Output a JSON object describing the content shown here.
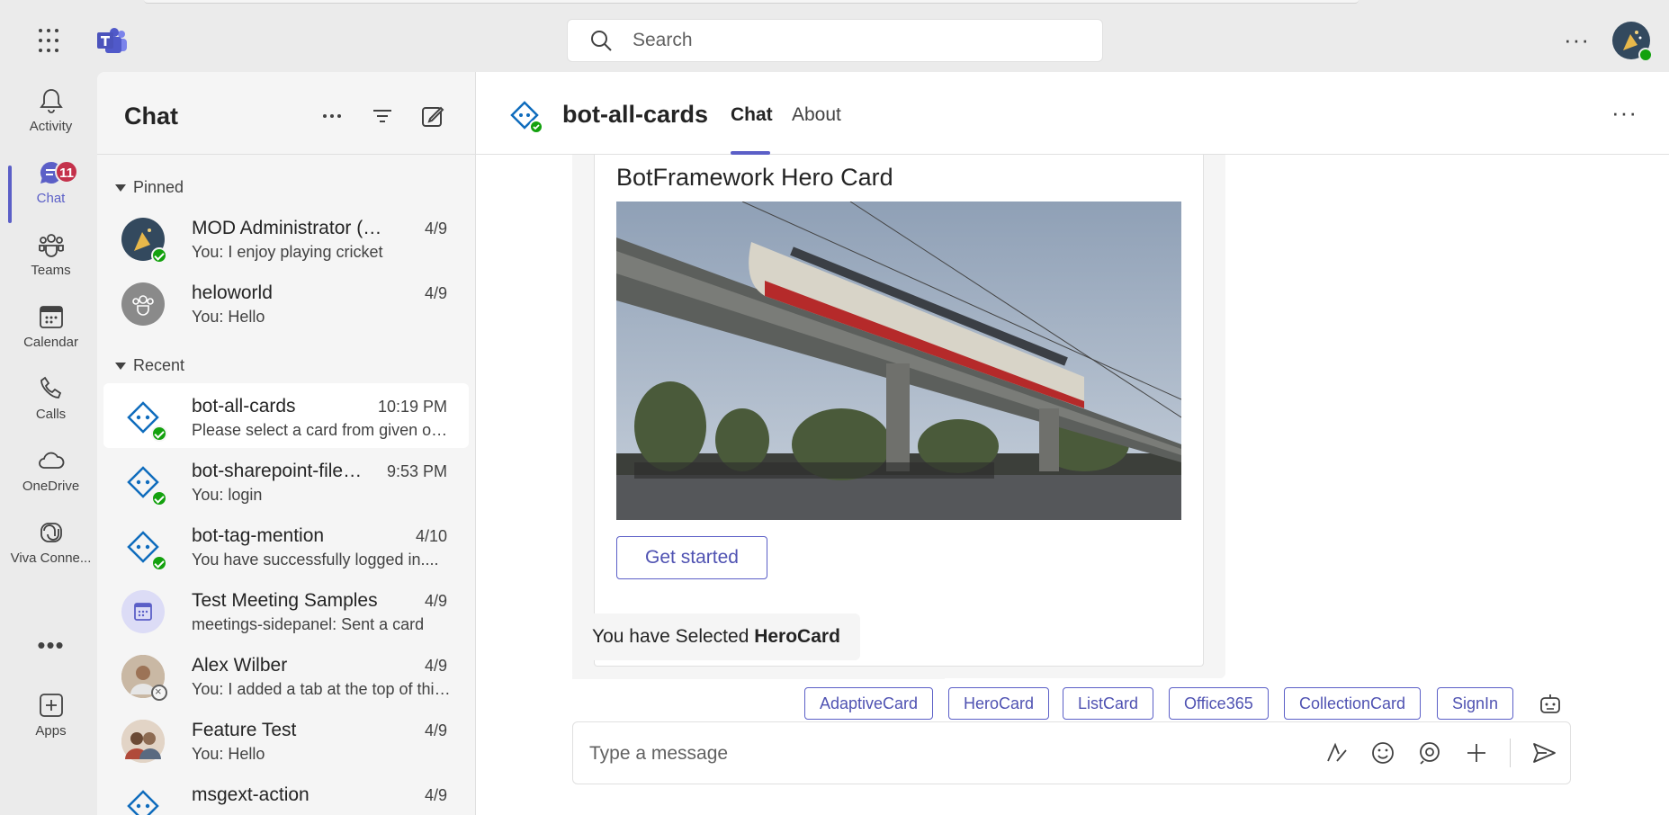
{
  "app": {
    "search_placeholder": "Search",
    "more_label": "···"
  },
  "rail": {
    "items": [
      {
        "label": "Activity",
        "icon": "bell-icon"
      },
      {
        "label": "Chat",
        "icon": "chat-icon",
        "badge": "11"
      },
      {
        "label": "Teams",
        "icon": "teams-icon"
      },
      {
        "label": "Calendar",
        "icon": "calendar-icon"
      },
      {
        "label": "Calls",
        "icon": "phone-icon"
      },
      {
        "label": "OneDrive",
        "icon": "cloud-icon"
      },
      {
        "label": "Viva Conne...",
        "icon": "viva-icon"
      },
      {
        "label": "Apps",
        "icon": "add-app-icon"
      }
    ],
    "more": "•••"
  },
  "chatlist": {
    "title": "Chat",
    "pinned_label": "Pinned",
    "recent_label": "Recent",
    "pinned": [
      {
        "name": "MOD Administrator (You)",
        "time": "4/9",
        "preview": "You: I enjoy playing cricket"
      },
      {
        "name": "heloworld",
        "time": "4/9",
        "preview": "You: Hello"
      }
    ],
    "recent": [
      {
        "name": "bot-all-cards",
        "time": "10:19 PM",
        "preview": "Please select a card from given options"
      },
      {
        "name": "bot-sharepoint-file-viewer",
        "time": "9:53 PM",
        "preview": "You: login"
      },
      {
        "name": "bot-tag-mention",
        "time": "4/10",
        "preview": "You have successfully logged in...."
      },
      {
        "name": "Test Meeting Samples",
        "time": "4/9",
        "preview": "meetings-sidepanel: Sent a card"
      },
      {
        "name": "Alex Wilber",
        "time": "4/9",
        "preview": "You: I added a tab at the top of this chat"
      },
      {
        "name": "Feature Test",
        "time": "4/9",
        "preview": "You: Hello"
      },
      {
        "name": "msgext-action",
        "time": "4/9",
        "preview": ""
      }
    ]
  },
  "main": {
    "title": "bot-all-cards",
    "tabs": [
      "Chat",
      "About"
    ],
    "more": "···",
    "card": {
      "title": "BotFramework Hero Card",
      "button": "Get started"
    },
    "message": {
      "prefix": "You have Selected ",
      "bold": "HeroCard"
    },
    "suggestions": [
      "AdaptiveCard",
      "HeroCard",
      "ListCard",
      "Office365",
      "CollectionCard",
      "SignIn"
    ],
    "composer_placeholder": "Type a message"
  },
  "colors": {
    "accent": "#5b5fc7",
    "badge": "#c4314b",
    "presence": "#13a10e"
  }
}
